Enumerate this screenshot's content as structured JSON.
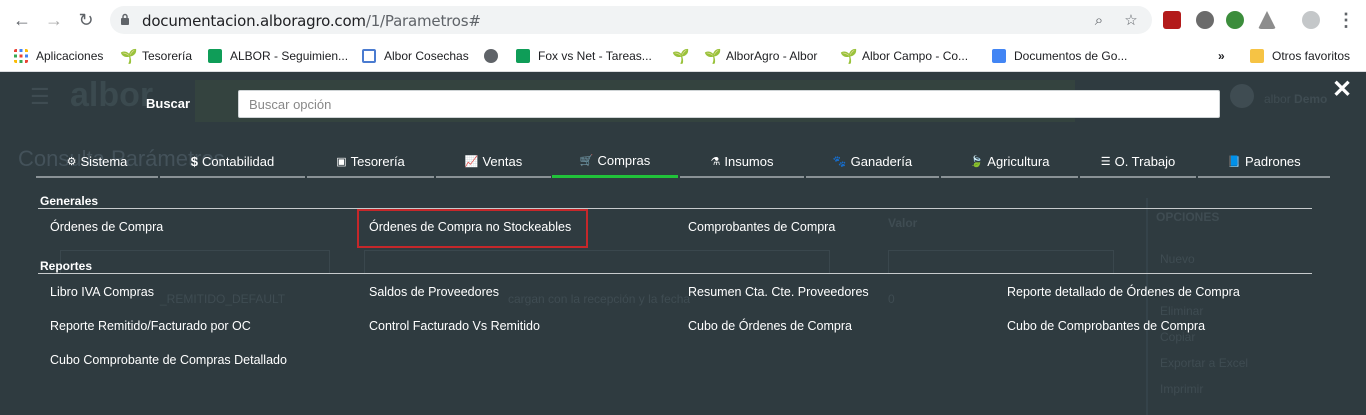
{
  "browser": {
    "url_host": "documentacion.alboragro.com",
    "url_path": "/1/Parametros#",
    "bookmarks": [
      {
        "label": "Aplicaciones",
        "icon": "apps-grid-icon"
      },
      {
        "label": "Tesorería",
        "icon": "sprout-icon"
      },
      {
        "label": "ALBOR - Seguimien...",
        "icon": "sheets-icon"
      },
      {
        "label": "Albor Cosechas",
        "icon": "window-icon"
      },
      {
        "label": "",
        "icon": "globe-icon"
      },
      {
        "label": "Fox vs Net - Tareas...",
        "icon": "sheets-icon"
      },
      {
        "label": "",
        "icon": "sprout-icon"
      },
      {
        "label": "AlborAgro - Albor",
        "icon": "sprout-icon"
      },
      {
        "label": "Albor Campo - Co...",
        "icon": "sprout-icon"
      },
      {
        "label": "Documentos de Go...",
        "icon": "docs-icon"
      }
    ],
    "more_bookmarks": "»",
    "other_favorites": "Otros favoritos"
  },
  "app": {
    "background_text": {
      "logo": "albor",
      "user": "albor",
      "user_bold": "Demo",
      "page_title": "Consulta Parámetros",
      "col_valor": "Valor",
      "options_header": "OPCIONES",
      "options": [
        "Nuevo",
        "Eliminar",
        "Copiar",
        "Exportar a Excel",
        "Imprimir"
      ],
      "row_text": "_REMITIDO_DEFAULT",
      "row_desc": "cargan con la recepción y la fecha",
      "row_value": "0"
    }
  },
  "overlay": {
    "search_label": "Buscar",
    "search_placeholder": "Buscar opción",
    "close_glyph": "✕",
    "tabs": [
      {
        "label": "Sistema",
        "icon": "cogs-icon",
        "glyph": "⚙"
      },
      {
        "label": "Contabilidad",
        "icon": "dollar-icon",
        "glyph": "$"
      },
      {
        "label": "Tesorería",
        "icon": "money-icon",
        "glyph": "▣"
      },
      {
        "label": "Ventas",
        "icon": "line-chart-icon",
        "glyph": "📈"
      },
      {
        "label": "Compras",
        "icon": "basket-icon",
        "glyph": "🛒",
        "active": true
      },
      {
        "label": "Insumos",
        "icon": "flask-icon",
        "glyph": "⚗"
      },
      {
        "label": "Ganadería",
        "icon": "paw-icon",
        "glyph": "🐾"
      },
      {
        "label": "Agricultura",
        "icon": "leaf-icon",
        "glyph": "🍃"
      },
      {
        "label": "O. Trabajo",
        "icon": "list-icon",
        "glyph": "☰"
      },
      {
        "label": "Padrones",
        "icon": "book-icon",
        "glyph": "📘"
      }
    ],
    "sections": [
      {
        "title": "Generales",
        "items": [
          "Órdenes de Compra",
          "Órdenes de Compra no Stockeables",
          "Comprobantes de Compra"
        ]
      },
      {
        "title": "Reportes",
        "items": [
          "Libro IVA Compras",
          "Saldos de Proveedores",
          "Resumen Cta. Cte. Proveedores",
          "Reporte detallado de Órdenes de Compra",
          "Reporte Remitido/Facturado por OC",
          "Control Facturado Vs Remitido",
          "Cubo de Órdenes de Compra",
          "Cubo de Comprobantes de Compra",
          "Cubo Comprobante de Compras Detallado"
        ]
      }
    ],
    "highlighted_item": "Órdenes de Compra no Stockeables",
    "colors": {
      "active_tab": "#21c23a",
      "highlight": "#c6272a",
      "overlay_bg": "#2f3b40"
    }
  }
}
